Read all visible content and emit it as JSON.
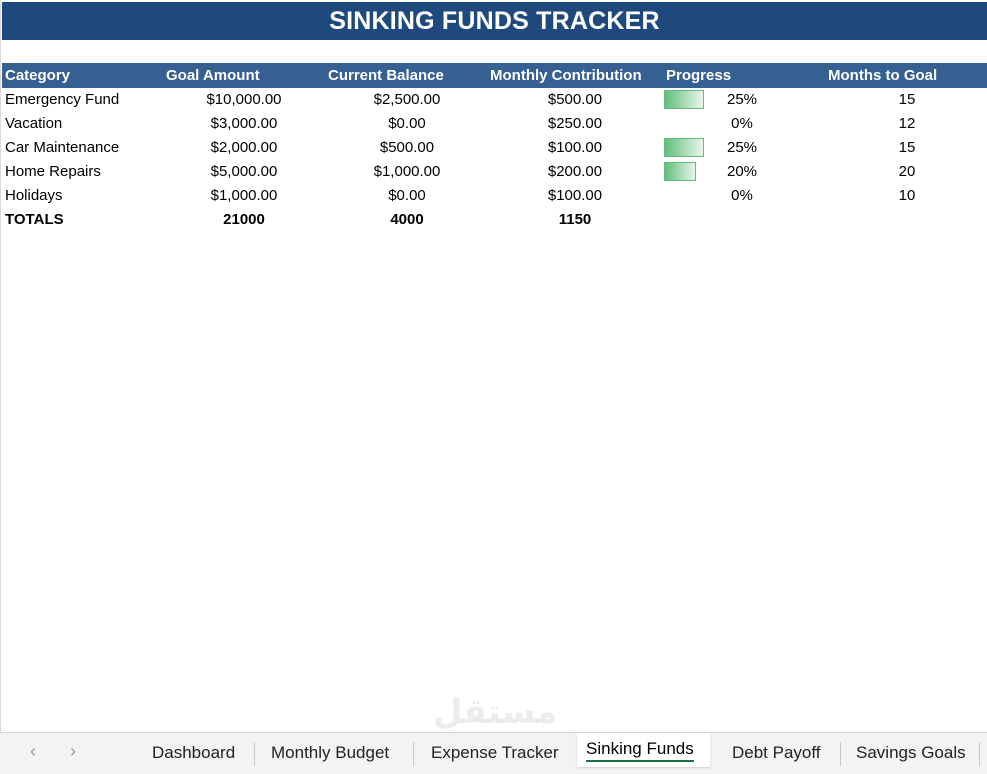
{
  "title": "SINKING FUNDS TRACKER",
  "colors": {
    "title_bg": "#1f497d",
    "header_bg": "#366092",
    "progress_bar": "#63be7b",
    "active_tab_underline": "#1e7145"
  },
  "table": {
    "headers": [
      "Category",
      "Goal Amount",
      "Current Balance",
      "Monthly Contribution",
      "Progress",
      "Months to Goal"
    ],
    "rows": [
      {
        "category": "Emergency Fund",
        "goal": "$10,000.00",
        "balance": "$2,500.00",
        "monthly": "$500.00",
        "progress": "25%",
        "progress_value": 0.25,
        "months": "15"
      },
      {
        "category": "Vacation",
        "goal": "$3,000.00",
        "balance": "$0.00",
        "monthly": "$250.00",
        "progress": "0%",
        "progress_value": 0,
        "months": "12"
      },
      {
        "category": "Car Maintenance",
        "goal": "$2,000.00",
        "balance": "$500.00",
        "monthly": "$100.00",
        "progress": "25%",
        "progress_value": 0.25,
        "months": "15"
      },
      {
        "category": "Home Repairs",
        "goal": "$5,000.00",
        "balance": "$1,000.00",
        "monthly": "$200.00",
        "progress": "20%",
        "progress_value": 0.2,
        "months": "20"
      },
      {
        "category": "Holidays",
        "goal": "$1,000.00",
        "balance": "$0.00",
        "monthly": "$100.00",
        "progress": "0%",
        "progress_value": 0,
        "months": "10"
      }
    ],
    "totals": {
      "label": "TOTALS",
      "goal": "21000",
      "balance": "4000",
      "monthly": "1150"
    }
  },
  "tabs": {
    "nav_prev_icon": "chevron-left-icon",
    "nav_next_icon": "chevron-right-icon",
    "items": [
      {
        "label": "Dashboard",
        "active": false
      },
      {
        "label": "Monthly Budget",
        "active": false
      },
      {
        "label": "Expense Tracker",
        "active": false
      },
      {
        "label": "Sinking Funds",
        "active": true
      },
      {
        "label": "Debt Payoff",
        "active": false
      },
      {
        "label": "Savings Goals",
        "active": false
      }
    ]
  },
  "watermark": "مستقل"
}
